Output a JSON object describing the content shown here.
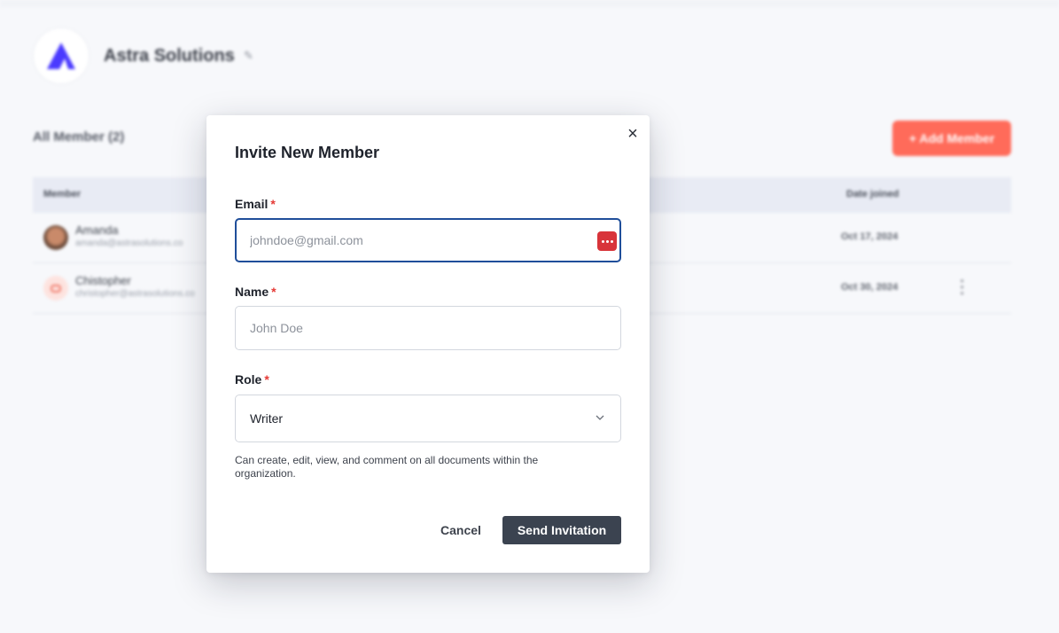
{
  "organization": {
    "name": "Astra Solutions",
    "logo_icon": "astra-logo",
    "edit_icon": "pencil-icon"
  },
  "members": {
    "title": "All Member (2)",
    "add_button_label": "+ Add Member",
    "columns": {
      "member": "Member",
      "date_joined": "Date joined"
    },
    "rows": [
      {
        "name": "Amanda",
        "email": "amanda@astrasolutions.co",
        "date_joined": "Oct 17, 2024"
      },
      {
        "name": "Chistopher",
        "email": "christopher@astrasolutions.co",
        "date_joined": "Oct 30, 2024"
      }
    ]
  },
  "modal": {
    "title": "Invite New Member",
    "close_label": "×",
    "email": {
      "label": "Email",
      "required_mark": "*",
      "value": "",
      "placeholder": "johndoe@gmail.com"
    },
    "name": {
      "label": "Name",
      "required_mark": "*",
      "value": "",
      "placeholder": "John Doe"
    },
    "role": {
      "label": "Role",
      "required_mark": "*",
      "value": "Writer"
    },
    "role_help": "Can create, edit, view, and comment on all documents within the organization.",
    "cancel_label": "Cancel",
    "send_label": "Send Invitation"
  },
  "colors": {
    "accent": "#ff6b5a",
    "primary_button": "#3b4350",
    "focus_border": "#1f4e9a",
    "required": "#e53935",
    "password_manager": "#d8343a",
    "logo": "#4a3aff"
  }
}
